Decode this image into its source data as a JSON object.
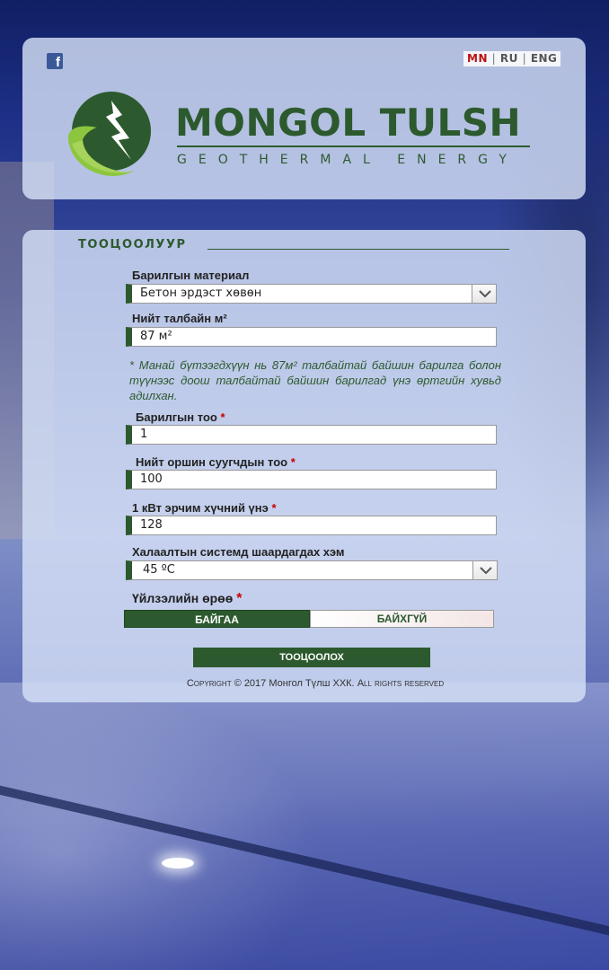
{
  "header": {
    "facebook_icon": "facebook-icon",
    "languages": [
      {
        "label": "MN",
        "active": true
      },
      {
        "label": "RU",
        "active": false
      },
      {
        "label": "ENG",
        "active": false
      }
    ],
    "lang_separator": "|",
    "brand_name": "MONGOL TULSH",
    "brand_tagline": "GEOTHERMAL ENERGY",
    "logo_icon": "leaf-lightning-logo",
    "brand_color": "#2c5a2e"
  },
  "calculator": {
    "title": "ТООЦООЛУУР",
    "material": {
      "label": "Барилгын материал",
      "value": "Бетон эрдэст хөвөн"
    },
    "area": {
      "label": "Нийт талбайн м²",
      "value": "87 м²"
    },
    "note": "* Манай бүтээгдхүүн нь 87м² талбайтай байшин барилга болон түүнээс доош талбайтай байшин барилгад үнэ өртгийн хувьд адилхан.",
    "building_count": {
      "label": "Барилгын тоо",
      "required": "*",
      "value": "1"
    },
    "residents": {
      "label": "Нийт оршин суугчдын тоо",
      "required": "*",
      "value": "100"
    },
    "kwh_price": {
      "label": "1 кВт эрчим хүчний үнэ",
      "required": "*",
      "value": "128"
    },
    "heating": {
      "label": "Халаалтын системд шаардагдах хэм",
      "value": "45 ºC"
    },
    "ventilation": {
      "label": "Үйлзэлийн өрөө",
      "required": "*",
      "options": [
        "БАЙГАА",
        "БАЙХГҮЙ"
      ],
      "selected": "БАЙГАА"
    },
    "submit_label": "ТООЦООЛОХ"
  },
  "footer": {
    "copyright_prefix": "Copyright",
    "copyright_year": "© 2017",
    "company": "Монгол Түлш ХХК.",
    "rights": "All rights reserved"
  }
}
